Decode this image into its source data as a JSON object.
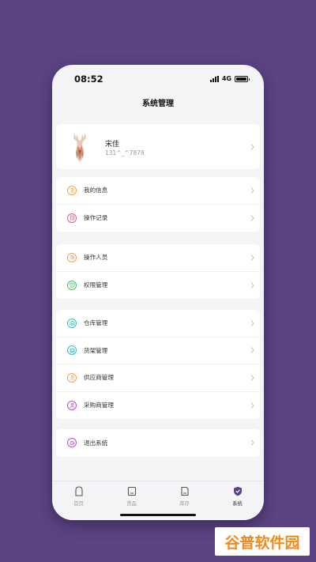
{
  "status_bar": {
    "time": "08:52",
    "network": "4G"
  },
  "page": {
    "title": "系统管理"
  },
  "profile": {
    "name": "宋佳",
    "phone": "131^_^7878"
  },
  "groups": [
    [
      {
        "label": "我的信息",
        "icon": "user-info-icon",
        "color": "#f0a34a"
      },
      {
        "label": "操作记录",
        "icon": "record-list-icon",
        "color": "#e0607e"
      }
    ],
    [
      {
        "label": "操作人员",
        "icon": "operators-icon",
        "color": "#f0a34a"
      },
      {
        "label": "权限管理",
        "icon": "shield-permission-icon",
        "color": "#4cc06a"
      }
    ],
    [
      {
        "label": "仓库管理",
        "icon": "warehouse-icon",
        "color": "#38bcc4"
      },
      {
        "label": "货架管理",
        "icon": "shelf-icon",
        "color": "#38bcc4"
      },
      {
        "label": "供应商管理",
        "icon": "supplier-icon",
        "color": "#f0a34a"
      },
      {
        "label": "采购商管理",
        "icon": "purchaser-icon",
        "color": "#b454d0"
      }
    ],
    [
      {
        "label": "退出系统",
        "icon": "logout-icon",
        "color": "#b454d0"
      }
    ]
  ],
  "tabs": [
    {
      "label": "首页",
      "icon": "home-doc-icon",
      "active": false
    },
    {
      "label": "货品",
      "icon": "goods-icon",
      "active": false
    },
    {
      "label": "库存",
      "icon": "inventory-icon",
      "active": false
    },
    {
      "label": "系统",
      "icon": "system-shield-icon",
      "active": true
    }
  ],
  "colors": {
    "background": "#5b4384",
    "accent": "#5b4384"
  },
  "watermark": {
    "text": "谷普软件园"
  }
}
